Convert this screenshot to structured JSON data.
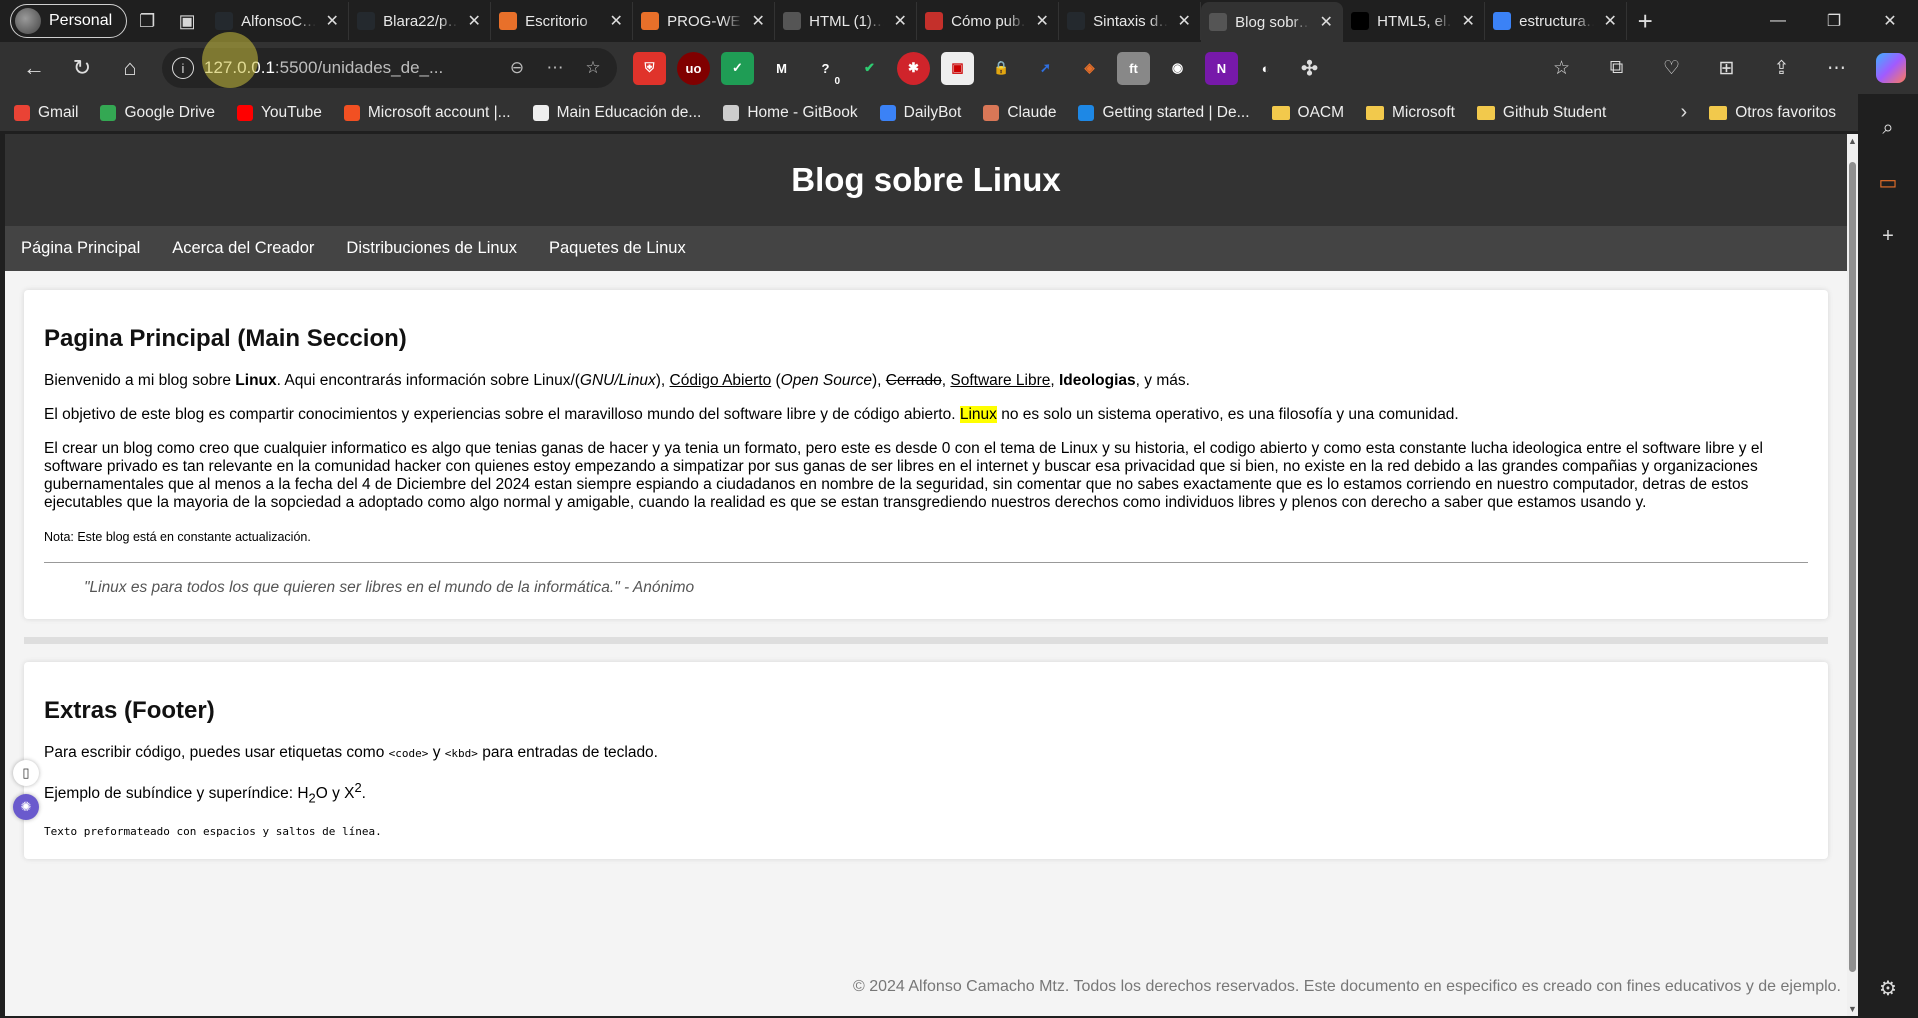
{
  "browser": {
    "profile_label": "Personal",
    "tabs": [
      {
        "title": "AlfonsoC…",
        "icon": "github-icon",
        "color": "#24292e"
      },
      {
        "title": "Blara22/p…",
        "icon": "github-icon",
        "color": "#24292e"
      },
      {
        "title": "Escritorio",
        "icon": "m-logo-icon",
        "color": "#e8702a"
      },
      {
        "title": "PROG-WE…",
        "icon": "m-logo-icon",
        "color": "#e8702a"
      },
      {
        "title": "HTML (1)…",
        "icon": "document-icon",
        "color": "#555"
      },
      {
        "title": "Cómo pub…",
        "icon": "youtube-icon",
        "color": "#c4302b"
      },
      {
        "title": "Sintaxis d…",
        "icon": "github-icon",
        "color": "#24292e"
      },
      {
        "title": "Blog sobr…",
        "icon": "document-icon",
        "color": "#555",
        "active": true
      },
      {
        "title": "HTML5, el…",
        "icon": "e-logo-icon",
        "color": "#000"
      },
      {
        "title": "estructura…",
        "icon": "search-icon",
        "color": "#3b82f6"
      }
    ],
    "address": {
      "host": "127.0.0.1",
      "path": ":5500/unidades_de_..."
    },
    "bookmarks": [
      {
        "label": "Gmail",
        "icon": "gmail-icon",
        "color": "#ea4335"
      },
      {
        "label": "Google Drive",
        "icon": "drive-icon",
        "color": "#34a853"
      },
      {
        "label": "YouTube",
        "icon": "youtube-icon",
        "color": "#ff0000"
      },
      {
        "label": "Microsoft account |...",
        "icon": "microsoft-icon",
        "color": "#f25022"
      },
      {
        "label": "Main Educación de...",
        "icon": "github-icon",
        "color": "#eeeeee"
      },
      {
        "label": "Home - GitBook",
        "icon": "gitbook-icon",
        "color": "#cccccc"
      },
      {
        "label": "DailyBot",
        "icon": "dailybot-icon",
        "color": "#3b82f6"
      },
      {
        "label": "Claude",
        "icon": "claude-icon",
        "color": "#d97757"
      },
      {
        "label": "Getting started | De...",
        "icon": "edge-icon",
        "color": "#1e88e5"
      },
      {
        "label": "OACM",
        "icon": "folder-icon",
        "folder": true
      },
      {
        "label": "Microsoft",
        "icon": "folder-icon",
        "folder": true
      },
      {
        "label": "Github Student",
        "icon": "folder-icon",
        "folder": true
      }
    ],
    "other_favorites": "Otros favoritos",
    "extension_badge": "0"
  },
  "page": {
    "header_title": "Blog sobre Linux",
    "nav": [
      "Página Principal",
      "Acerca del Creador",
      "Distribuciones de Linux",
      "Paquetes de Linux"
    ],
    "main": {
      "heading": "Pagina Principal (Main Seccion)",
      "p1": {
        "a": "Bienvenido a mi blog sobre ",
        "b": "Linux",
        "c": ". Aqui encontrarás información sobre Linux/(",
        "d": "GNU/Linux",
        "e": "), ",
        "f": "Código Abierto",
        "g": " (",
        "h": "Open Source",
        "i": "), ",
        "j": "Cerrado",
        "k": ", ",
        "l": "Software Libre",
        "m": ", ",
        "n": "Ideologias",
        "o": ", y más."
      },
      "p2": {
        "a": "El objetivo de este blog es compartir conocimientos y experiencias sobre el maravilloso mundo del software libre y de código abierto. ",
        "b": "Linux",
        "c": " no es solo un sistema operativo, es una filosofía y una comunidad."
      },
      "p3": "El crear un blog como creo que cualquier informatico es algo que tenias ganas de hacer y ya tenia un formato, pero este es desde 0 con el tema de Linux y su historia, el codigo abierto y como esta constante lucha ideologica entre el software libre y el software privado es tan relevante en la comunidad hacker con quienes estoy empezando a simpatizar por sus ganas de ser libres en el internet y buscar esa privacidad que si bien, no existe en la red debido a las grandes compañias y organizaciones gubernamentales que al menos a la fecha del 4 de Diciembre del 2024 estan siempre espiando a ciudadanos en nombre de la seguridad, sin comentar que no sabes exactamente que es lo estamos corriendo en nuestro computador, detras de estos ejecutables que la mayoria de la sopciedad a adoptado como algo normal y amigable, cuando la realidad es que se estan transgrediendo nuestros derechos como individuos libres y plenos con derecho a saber que estamos usando y.",
      "note": "Nota: Este blog está en constante actualización.",
      "quote": "\"Linux es para todos los que quieren ser libres en el mundo de la informática.\" - Anónimo"
    },
    "extras": {
      "heading": "Extras (Footer)",
      "p1": {
        "a": "Para escribir código, puedes usar etiquetas como ",
        "code": "<code>",
        "b": " y ",
        "kbd": "<kbd>",
        "c": " para entradas de teclado."
      },
      "p2": {
        "a": "Ejemplo de subíndice y superíndice: H",
        "sub": "2",
        "b": "O y X",
        "sup": "2",
        "c": "."
      },
      "pre": "Texto preformateado con espacios y saltos de línea."
    },
    "footer": "© 2024 Alfonso Camacho Mtz. Todos los derechos reservados. Este documento en especifico es creado con fines educativos y de ejemplo."
  },
  "colors": {
    "header_bg": "#333333",
    "nav_bg": "#444444",
    "highlight": "#ffff00",
    "chrome_bg": "#1f1f1f"
  }
}
